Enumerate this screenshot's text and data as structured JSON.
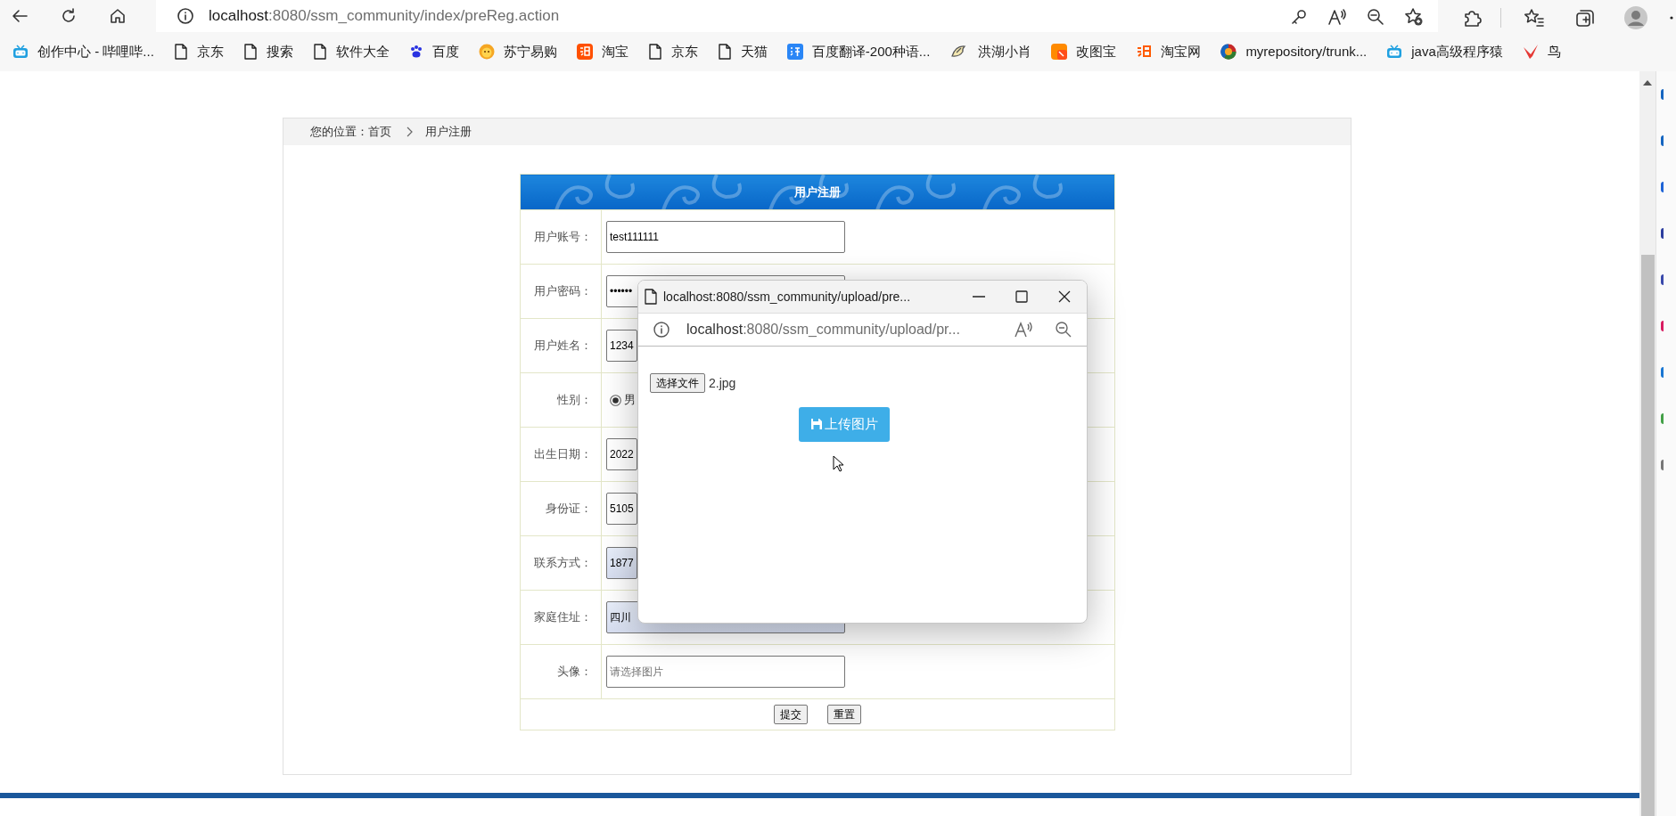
{
  "browser": {
    "address": {
      "host": "localhost",
      "path": ":8080/ssm_community/index/preReg.action"
    },
    "bookmarks": [
      {
        "kind": "tv",
        "label": "创作中心 - 哔哩哔..."
      },
      {
        "kind": "page",
        "label": "京东"
      },
      {
        "kind": "page",
        "label": "搜索"
      },
      {
        "kind": "page",
        "label": "软件大全"
      },
      {
        "kind": "paw",
        "label": "百度"
      },
      {
        "kind": "lion",
        "label": "苏宁易购"
      },
      {
        "kind": "tao",
        "label": "淘宝"
      },
      {
        "kind": "page",
        "label": "京东"
      },
      {
        "kind": "page",
        "label": "天猫"
      },
      {
        "kind": "translate",
        "label": "百度翻译-200种语..."
      },
      {
        "kind": "sketch",
        "label": "洪湖小肖"
      },
      {
        "kind": "tile",
        "label": "改图宝"
      },
      {
        "kind": "tao-plain",
        "label": "淘宝网"
      },
      {
        "kind": "ring",
        "label": "myrepository/trunk..."
      },
      {
        "kind": "tv",
        "label": "java高级程序猿"
      },
      {
        "kind": "bird",
        "label": "鸟"
      }
    ]
  },
  "breadcrumb": {
    "label": "您的位置：",
    "home": "首页",
    "current": "用户注册"
  },
  "form": {
    "title": "用户注册",
    "fields": [
      {
        "kind": "text",
        "label": "用户账号：",
        "value": "test111111",
        "autofilled": false
      },
      {
        "kind": "text",
        "label": "用户密码：",
        "value": "••••••",
        "autofilled": false
      },
      {
        "kind": "text",
        "label": "用户姓名：",
        "value": "1234",
        "autofilled": false
      },
      {
        "kind": "radio",
        "label": "性别：",
        "options": [
          {
            "label": "男",
            "selected": true
          }
        ]
      },
      {
        "kind": "text",
        "label": "出生日期：",
        "value": "2022",
        "autofilled": false
      },
      {
        "kind": "text",
        "label": "身份证：",
        "value": "5105",
        "autofilled": false
      },
      {
        "kind": "text",
        "label": "联系方式：",
        "value": "1877",
        "autofilled": true
      },
      {
        "kind": "text",
        "label": "家庭住址：",
        "value": "四川",
        "autofilled": true
      },
      {
        "kind": "text",
        "label": "头像：",
        "placeholder": "请选择图片",
        "autofilled": false
      }
    ],
    "buttons": [
      "提交",
      "重置"
    ]
  },
  "popup": {
    "title": "localhost:8080/ssm_community/upload/pre...",
    "address": {
      "host": "localhost",
      "path": ":8080/ssm_community/upload/pr..."
    },
    "file_button": "选择文件",
    "file_name": "2.jpg",
    "upload_button": "上传图片"
  }
}
